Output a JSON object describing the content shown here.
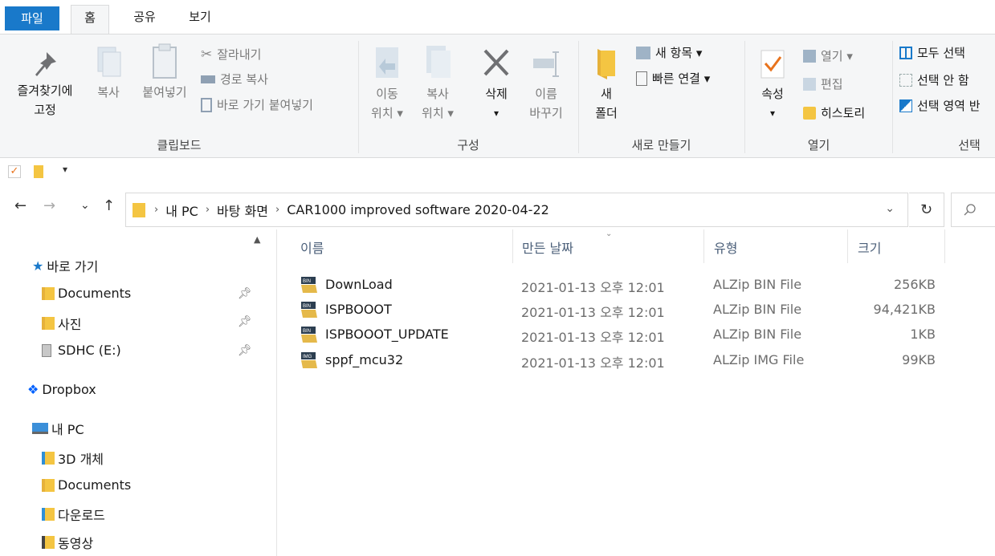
{
  "tabs": {
    "file": "파일",
    "home": "홈",
    "share": "공유",
    "view": "보기"
  },
  "ribbon": {
    "clipboard": {
      "pin_line1": "즐겨찾기에",
      "pin_line2": "고정",
      "copy": "복사",
      "paste": "붙여넣기",
      "cut": "잘라내기",
      "copy_path": "경로 복사",
      "paste_shortcut": "바로 가기 붙여넣기",
      "group": "클립보드"
    },
    "organize": {
      "move_line1": "이동",
      "move_line2": "위치 ▾",
      "copyto_line1": "복사",
      "copyto_line2": "위치 ▾",
      "delete_line1": "삭제",
      "delete_line2": "▾",
      "rename_line1": "이름",
      "rename_line2": "바꾸기",
      "group": "구성"
    },
    "new": {
      "folder_line1": "새",
      "folder_line2": "폴더",
      "new_item": "새 항목 ▾",
      "easy_access": "빠른 연결 ▾",
      "group": "새로 만들기"
    },
    "open": {
      "properties_line1": "속성",
      "properties_line2": "▾",
      "open": "열기 ▾",
      "edit": "편집",
      "history": "히스토리",
      "group": "열기"
    },
    "select": {
      "select_all": "모두 선택",
      "select_none": "선택 안 함",
      "invert": "선택 영역 반",
      "group": "선택"
    }
  },
  "qat": {
    "dropdown": "▾"
  },
  "nav": {
    "back": "←",
    "forward": "→",
    "recent": "⌄",
    "up": "↑",
    "path": [
      "내 PC",
      "바탕 화면",
      "CAR1000 improved software 2020-04-22"
    ],
    "addr_dropdown": "⌄",
    "refresh": "↻"
  },
  "sidebar": {
    "quick_access": "바로 가기",
    "items": [
      {
        "label": "Documents"
      },
      {
        "label": "사진"
      },
      {
        "label": "SDHC (E:)"
      }
    ],
    "dropbox": "Dropbox",
    "this_pc": "내 PC",
    "pc_items": [
      {
        "label": "3D 개체"
      },
      {
        "label": "Documents"
      },
      {
        "label": "다운로드"
      },
      {
        "label": "동영상"
      }
    ]
  },
  "columns": {
    "name": "이름",
    "date": "만든 날짜",
    "type": "유형",
    "size": "크기"
  },
  "files": [
    {
      "name": "DownLoad",
      "date": "2021-01-13 오후 12:01",
      "type": "ALZip BIN File",
      "size": "256KB",
      "badge": "BIN"
    },
    {
      "name": "ISPBOOOT",
      "date": "2021-01-13 오후 12:01",
      "type": "ALZip BIN File",
      "size": "94,421KB",
      "badge": "BIN"
    },
    {
      "name": "ISPBOOOT_UPDATE",
      "date": "2021-01-13 오후 12:01",
      "type": "ALZip BIN File",
      "size": "1KB",
      "badge": "BIN"
    },
    {
      "name": "sppf_mcu32",
      "date": "2021-01-13 오후 12:01",
      "type": "ALZip IMG File",
      "size": "99KB",
      "badge": "IMG"
    }
  ],
  "colors": {
    "accent": "#1979ca",
    "folder": "#f4c542",
    "ribbon_bg": "#f5f6f7",
    "header_text": "#4c607a"
  }
}
